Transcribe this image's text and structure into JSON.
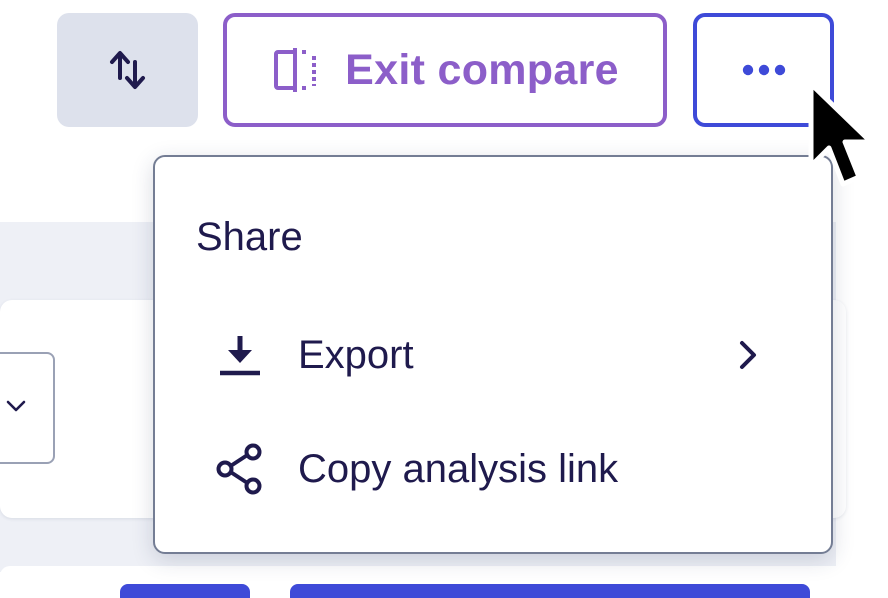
{
  "toolbar": {
    "sort_icon": "sort-arrows-icon",
    "exit_compare_label": "Exit compare",
    "exit_compare_icon": "split-compare-icon",
    "more_icon": "more-horizontal-icon"
  },
  "menu": {
    "heading": "Share",
    "items": [
      {
        "label": "Export",
        "icon": "download-icon",
        "has_submenu": true
      },
      {
        "label": "Copy analysis link",
        "icon": "share-icon",
        "has_submenu": false
      }
    ]
  },
  "colors": {
    "text": "#1f1a4d",
    "exit_accent": "#8c5ec9",
    "more_accent": "#3e4ad8",
    "sort_bg": "#dde1ec",
    "menu_border": "#747d94"
  }
}
